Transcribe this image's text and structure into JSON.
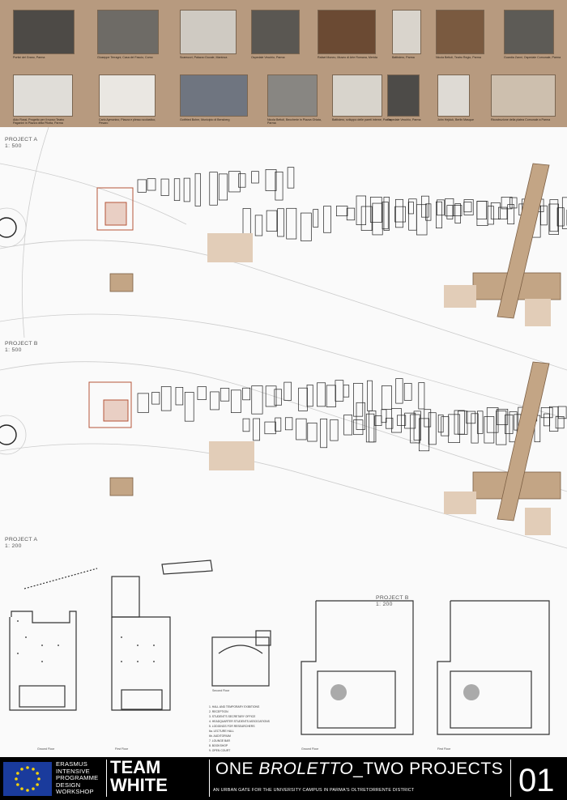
{
  "references_row1": [
    "Portici del Grano, Parma",
    "Giuseppe Terragni, Casa del Fascio, Como",
    "Scamozzi, Palazzo Ducale, Mantova",
    "Ospedale Vecchio, Parma",
    "Rafael Moneo, Museo di Arte Romana, Merida",
    "Battistero, Parma",
    "Nicola Bettoli, Teatro Regio, Parma",
    "Guardia Zanni, Ospedale Comunale, Parma"
  ],
  "references_row2": [
    "Aldo Rossi, Progetto per il nuovo Teatro Paganini in Piazza della Pilotta, Parma",
    "Carlo Aymonino, Piazza e plesso scolastico, Pesaro",
    "Gottfried Bohm, Municipio di Bensberg",
    "Nicola Bettoli, Beccherie in Piazza Ghiaia, Parma",
    "Battistero, sviluppo delle pareti interne, Parma",
    "Ospedale Vecchio, Parma",
    "John Hejduk, Berlin Masque",
    "Ricostruzione della platea Comunale a Parma"
  ],
  "sections": {
    "project_a_500": "PROJECT A",
    "project_a_500_scale": "1: 500",
    "project_b_500": "PROJECT B",
    "project_b_500_scale": "1: 500",
    "project_a_200": "PROJECT A",
    "project_a_200_scale": "1: 200",
    "project_b_200": "PROJECT B",
    "project_b_200_scale": "1: 200"
  },
  "floor_captions": {
    "a_ground": "Ground Floor",
    "a_first": "First Floor",
    "second": "Second Floor",
    "b_ground": "Ground Floor",
    "b_first": "First Floor"
  },
  "legend": [
    "1. HALL AND TEMPORARY EXIBITIONS",
    "2. RECEPTION",
    "3. STUDENT'S SECRETARY OFFICE",
    "4. HEADQUARTER STUDENTS ASSOCIATIONS",
    "5. LODGINGS FOR RESEARCHERS",
    "6a. LECTURE HALL",
    "6b. AUDITORIUM",
    "7. LOUNGE BAR",
    "8. BOOKSHOP",
    "9. OPEN COURT"
  ],
  "footer": {
    "erasmus_lines": [
      "ERASMUS",
      "INTENSIVE",
      "PROGRAMME",
      "DESIGN",
      "WORKSHOP"
    ],
    "team_line1": "TEAM",
    "team_line2": "WHITE",
    "title_pre": "ONE ",
    "title_em": "BROLETTO",
    "title_post": "_TWO PROJECTS",
    "subtitle": "AN URBAN GATE FOR THE UNIVERSITY CAMPUS IN PARMA'S OLTRETORRENTE DISTRICT",
    "page_number": "01"
  },
  "colors": {
    "reference_band": "#b79a7f",
    "highlight_tan": "#c3a585",
    "project_red": "#b5563a",
    "footer_bg": "#000000",
    "eu_blue": "#1a3b9c",
    "eu_star": "#f5d20a"
  }
}
